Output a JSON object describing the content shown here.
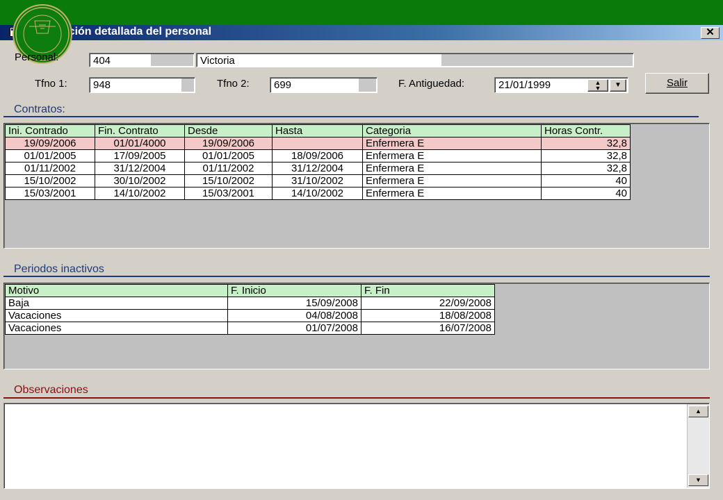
{
  "window": {
    "title": "Información detallada del personal",
    "close_label": "✕"
  },
  "personal": {
    "label": "Personal:",
    "id": "404",
    "name": "Victoria"
  },
  "phones": {
    "tfno1_label": "Tfno 1:",
    "tfno1_value": "948",
    "tfno2_label": "Tfno 2:",
    "tfno2_value": "699"
  },
  "antiguedad": {
    "label": "F. Antiguedad:",
    "value": "21/01/1999"
  },
  "buttons": {
    "salir_label": "Salir"
  },
  "contratos": {
    "title": "Contratos:",
    "columns": [
      "Ini. Contrado",
      "Fin. Contrato",
      "Desde",
      "Hasta",
      "Categoria",
      "Horas Contr."
    ],
    "rows": [
      [
        "19/09/2006",
        "01/01/4000",
        "19/09/2006",
        "",
        "Enfermera E",
        "32,8"
      ],
      [
        "01/01/2005",
        "17/09/2005",
        "01/01/2005",
        "18/09/2006",
        "Enfermera E",
        "32,8"
      ],
      [
        "01/11/2002",
        "31/12/2004",
        "01/11/2002",
        "31/12/2004",
        "Enfermera E",
        "32,8"
      ],
      [
        "15/10/2002",
        "30/10/2002",
        "15/10/2002",
        "31/10/2002",
        "Enfermera E",
        "40"
      ],
      [
        "15/03/2001",
        "14/10/2002",
        "15/03/2001",
        "14/10/2002",
        "Enfermera E",
        "40"
      ]
    ]
  },
  "periodos": {
    "title": "Periodos inactivos",
    "columns": [
      "Motivo",
      "F. Inicio",
      "F. Fin"
    ],
    "rows": [
      [
        "Baja",
        "15/09/2008",
        "22/09/2008"
      ],
      [
        "Vacaciones",
        "04/08/2008",
        "18/08/2008"
      ],
      [
        "Vacaciones",
        "01/07/2008",
        "16/07/2008"
      ]
    ]
  },
  "observaciones": {
    "title": "Observaciones",
    "text": ""
  },
  "colors": {
    "banner": "#0a7a0a",
    "header_green": "#c8f0c8",
    "selected_row": "#f5c8c8",
    "section_blue": "#1f3a7a"
  }
}
